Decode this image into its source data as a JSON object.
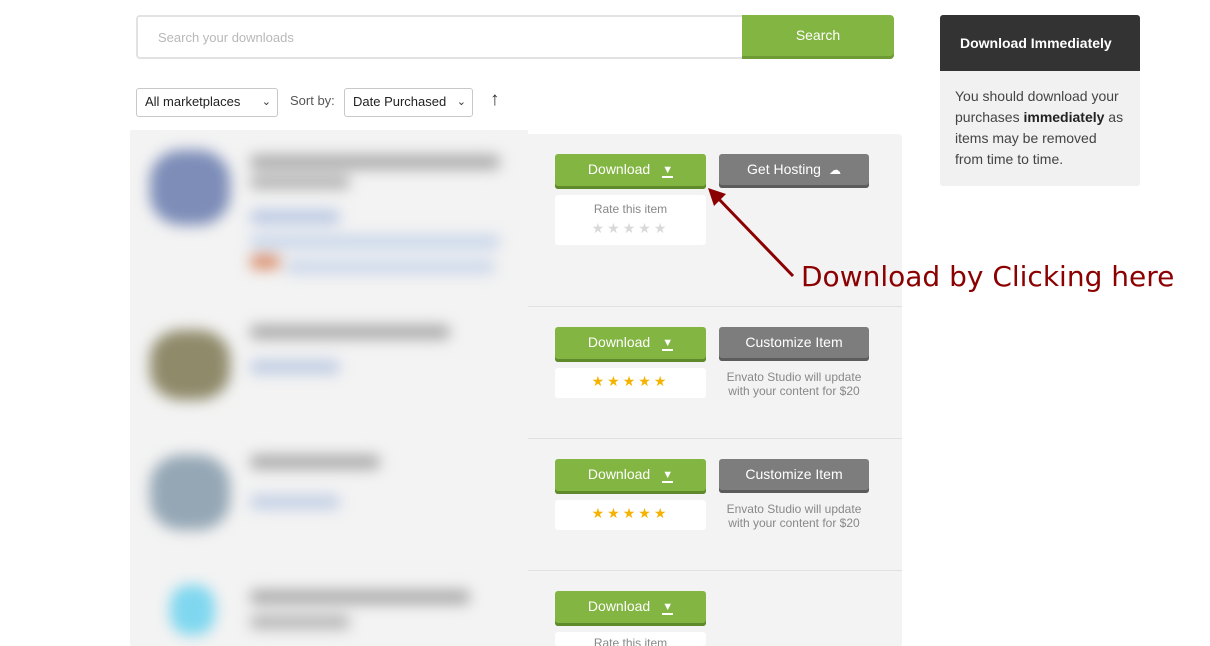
{
  "search": {
    "placeholder": "Search your downloads",
    "button_label": "Search"
  },
  "filters": {
    "marketplace_value": "All marketplaces",
    "sort_label": "Sort by:",
    "sort_value": "Date Purchased",
    "sort_direction_icon": "arrow-up-icon"
  },
  "items": [
    {
      "download_label": "Download",
      "secondary_label": "Get Hosting",
      "rate_label": "Rate this item",
      "stars": "★★★★★",
      "rating": 0
    },
    {
      "download_label": "Download",
      "secondary_label": "Customize Item",
      "stars": "★★★★★",
      "rating": 5,
      "note": "Envato Studio will update with your content for $20"
    },
    {
      "download_label": "Download",
      "secondary_label": "Customize Item",
      "stars": "★★★★★",
      "rating": 5,
      "note": "Envato Studio will update with your content for $20"
    },
    {
      "download_label": "Download",
      "rate_label": "Rate this item"
    }
  ],
  "sidebar": {
    "title": "Download Immediately",
    "text_before": "You should download your purchases ",
    "text_bold": "immediately",
    "text_after": " as items may be removed from time to time."
  },
  "annotation": {
    "text": "Download by Clicking here",
    "color": "#8b0000"
  },
  "colors": {
    "accent_green": "#82b541",
    "button_grey": "#7d7d7d",
    "sidebar_header": "#333333",
    "star": "#f5b301"
  }
}
